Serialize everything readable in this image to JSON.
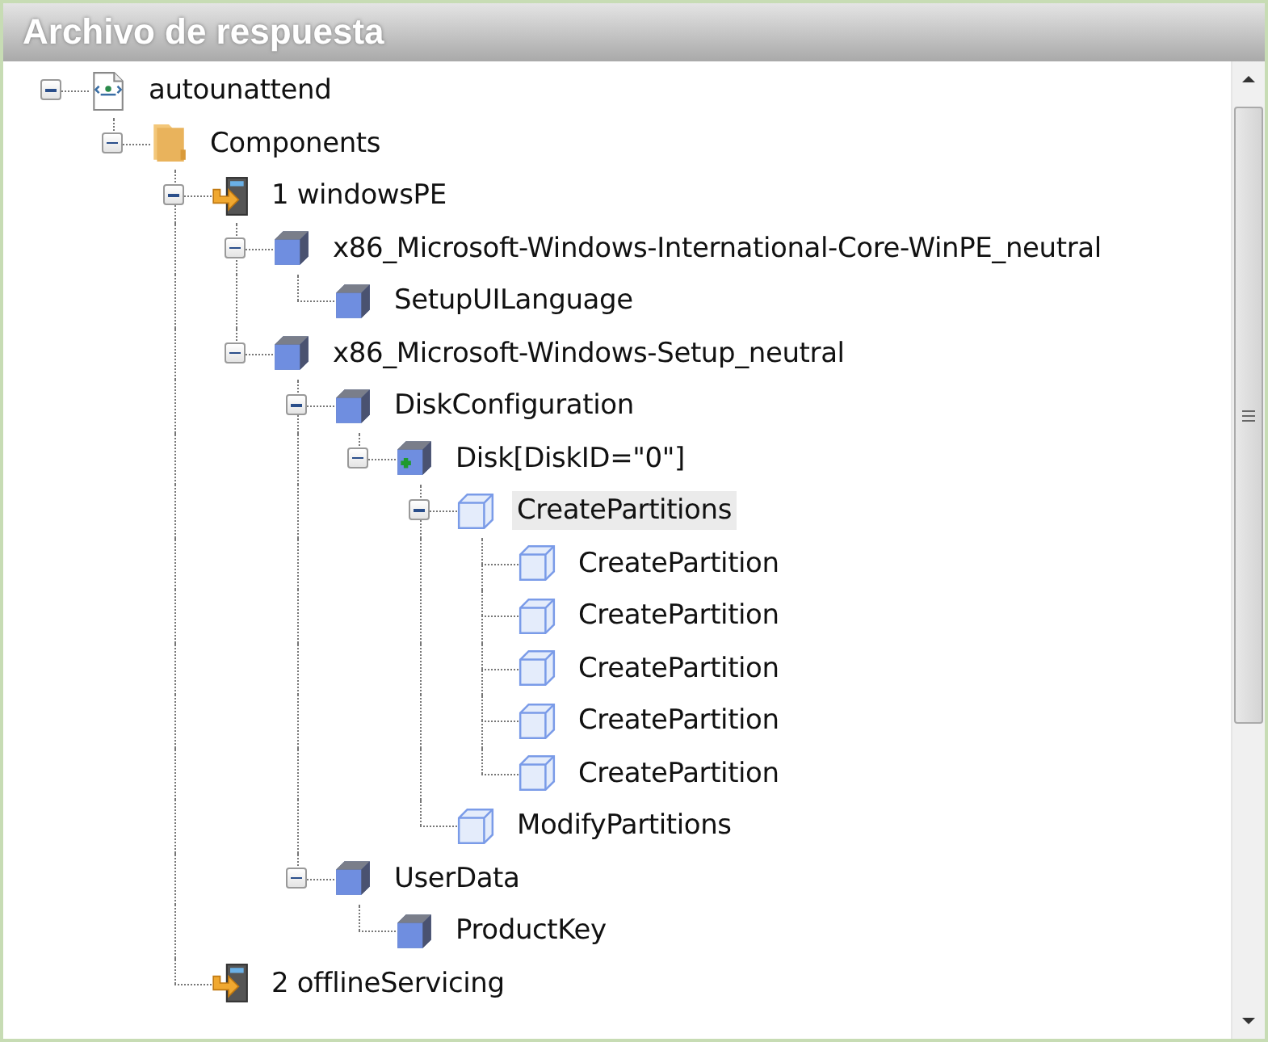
{
  "panel": {
    "title": "Archivo de respuesta"
  },
  "tree": [
    {
      "label": "autounattend",
      "kind": "document",
      "expanded": true,
      "selected": false,
      "children": [
        {
          "label": "Components",
          "kind": "folder",
          "expanded": true,
          "selected": false,
          "children": [
            {
              "label": "1 windowsPE",
              "kind": "pass",
              "expanded": true,
              "selected": false,
              "children": [
                {
                  "label": "x86_Microsoft-Windows-International-Core-WinPE_neutral",
                  "kind": "component",
                  "expanded": true,
                  "selected": false,
                  "children": [
                    {
                      "label": "SetupUILanguage",
                      "kind": "component",
                      "selected": false
                    }
                  ]
                },
                {
                  "label": "x86_Microsoft-Windows-Setup_neutral",
                  "kind": "component",
                  "expanded": true,
                  "selected": false,
                  "children": [
                    {
                      "label": "DiskConfiguration",
                      "kind": "component",
                      "expanded": true,
                      "selected": false,
                      "children": [
                        {
                          "label": "Disk[DiskID=\"0\"]",
                          "kind": "component-add",
                          "expanded": true,
                          "selected": false,
                          "children": [
                            {
                              "label": "CreatePartitions",
                              "kind": "item",
                              "expanded": true,
                              "selected": true,
                              "children": [
                                {
                                  "label": "CreatePartition",
                                  "kind": "item",
                                  "selected": false
                                },
                                {
                                  "label": "CreatePartition",
                                  "kind": "item",
                                  "selected": false
                                },
                                {
                                  "label": "CreatePartition",
                                  "kind": "item",
                                  "selected": false
                                },
                                {
                                  "label": "CreatePartition",
                                  "kind": "item",
                                  "selected": false
                                },
                                {
                                  "label": "CreatePartition",
                                  "kind": "item",
                                  "selected": false
                                }
                              ]
                            },
                            {
                              "label": "ModifyPartitions",
                              "kind": "item",
                              "selected": false
                            }
                          ]
                        }
                      ]
                    },
                    {
                      "label": "UserData",
                      "kind": "component",
                      "expanded": true,
                      "selected": false,
                      "children": [
                        {
                          "label": "ProductKey",
                          "kind": "component",
                          "selected": false
                        }
                      ]
                    }
                  ]
                }
              ]
            },
            {
              "label": "2 offlineServicing",
              "kind": "pass",
              "selected": false
            }
          ]
        }
      ]
    }
  ]
}
